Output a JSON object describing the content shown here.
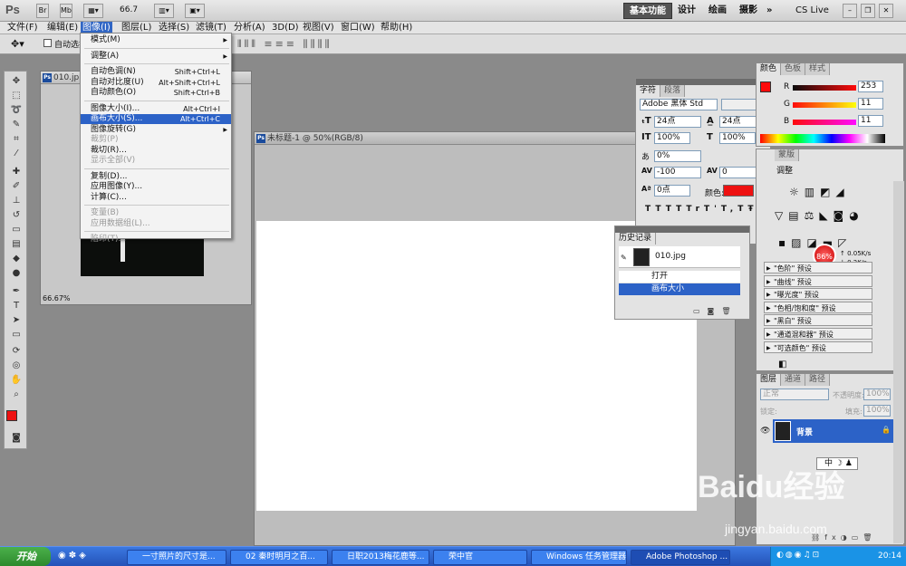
{
  "app": {
    "logo": "Ps",
    "zoom": "66.7",
    "workspaces": [
      "基本功能",
      "设计",
      "绘画",
      "摄影"
    ],
    "more": "»",
    "cslive": "CS Live"
  },
  "menu": [
    "文件(F)",
    "编辑(E)",
    "图像(I)",
    "图层(L)",
    "选择(S)",
    "滤镜(T)",
    "分析(A)",
    "3D(D)",
    "视图(V)",
    "窗口(W)",
    "帮助(H)"
  ],
  "options": {
    "auto_select": "自动选择"
  },
  "dropdown": [
    {
      "label": "模式(M)",
      "shortcut": "",
      "state": "arrow"
    },
    {
      "sep": true
    },
    {
      "label": "调整(A)",
      "shortcut": "",
      "state": "arrow"
    },
    {
      "sep": true
    },
    {
      "label": "自动色调(N)",
      "shortcut": "Shift+Ctrl+L",
      "state": ""
    },
    {
      "label": "自动对比度(U)",
      "shortcut": "Alt+Shift+Ctrl+L",
      "state": ""
    },
    {
      "label": "自动颜色(O)",
      "shortcut": "Shift+Ctrl+B",
      "state": ""
    },
    {
      "sep": true
    },
    {
      "label": "图像大小(I)...",
      "shortcut": "Alt+Ctrl+I",
      "state": ""
    },
    {
      "label": "画布大小(S)...",
      "shortcut": "Alt+Ctrl+C",
      "state": "sel"
    },
    {
      "label": "图像旋转(G)",
      "shortcut": "",
      "state": "arrow"
    },
    {
      "label": "裁剪(P)",
      "shortcut": "",
      "state": "dis"
    },
    {
      "label": "裁切(R)...",
      "shortcut": "",
      "state": ""
    },
    {
      "label": "显示全部(V)",
      "shortcut": "",
      "state": "dis"
    },
    {
      "sep": true
    },
    {
      "label": "复制(D)...",
      "shortcut": "",
      "state": ""
    },
    {
      "label": "应用图像(Y)...",
      "shortcut": "",
      "state": ""
    },
    {
      "label": "计算(C)...",
      "shortcut": "",
      "state": ""
    },
    {
      "sep": true
    },
    {
      "label": "变量(B)",
      "shortcut": "",
      "state": "dis"
    },
    {
      "label": "应用数据组(L)...",
      "shortcut": "",
      "state": "dis"
    },
    {
      "sep": true
    },
    {
      "label": "陷印(T)...",
      "shortcut": "",
      "state": "dis"
    }
  ],
  "doc1": {
    "title": "010.jp",
    "zoom": "66.67%"
  },
  "doc2": {
    "title": "未标题-1 @ 50%(RGB/8)"
  },
  "char": {
    "tabs": [
      "字符",
      "段落"
    ],
    "font": "Adobe 黑体 Std",
    "size": "24点",
    "leading": "24点",
    "vscale": "100%",
    "hscale": "100%",
    "tracking_pct": "0%",
    "kerning": "-100",
    "tracking": "0",
    "baseline": "0点",
    "color_label": "颜色:",
    "color": "#ee1111",
    "styles": [
      "T",
      "T",
      "TT",
      "Tr",
      "T'",
      "T,",
      "T",
      "Ŧ"
    ]
  },
  "history": {
    "title": "历史记录",
    "snapshot": "010.jpg",
    "steps": [
      "打开",
      "画布大小"
    ]
  },
  "color": {
    "tabs": [
      "颜色",
      "色板",
      "样式"
    ],
    "channels": [
      {
        "label": "R",
        "value": "253"
      },
      {
        "label": "G",
        "value": "11"
      },
      {
        "label": "B",
        "value": "11"
      }
    ]
  },
  "adjust": {
    "tab": "蒙版",
    "subtitle": "调整",
    "presets": [
      "\"色阶\" 预设",
      "\"曲线\" 预设",
      "\"曝光度\" 预设",
      "\"色相/饱和度\" 预设",
      "\"黑白\" 预设",
      "\"通道混和器\" 预设",
      "\"可选颜色\" 预设"
    ]
  },
  "net": {
    "pct": "86%",
    "up": "0.05K/s",
    "down": "0.2K/s"
  },
  "layers": {
    "tabs": [
      "图层",
      "通道",
      "路径"
    ],
    "mode": "正常",
    "opacity_label": "不透明度:",
    "opacity": "100%",
    "lock_label": "锁定:",
    "fill_label": "填充:",
    "fill": "100%",
    "layer_name": "背景"
  },
  "ime": {
    "label": "中"
  },
  "taskbar": {
    "start": "开始",
    "items": [
      "一寸照片的尺寸是...",
      "02 秦时明月之百...",
      "日职2013梅花鹿等...",
      "荣中官",
      "Windows 任务管理器",
      "Adobe Photoshop ..."
    ],
    "time": "20:14"
  },
  "watermark": {
    "brand": "Baidu经验",
    "url": "jingyan.baidu.com"
  }
}
